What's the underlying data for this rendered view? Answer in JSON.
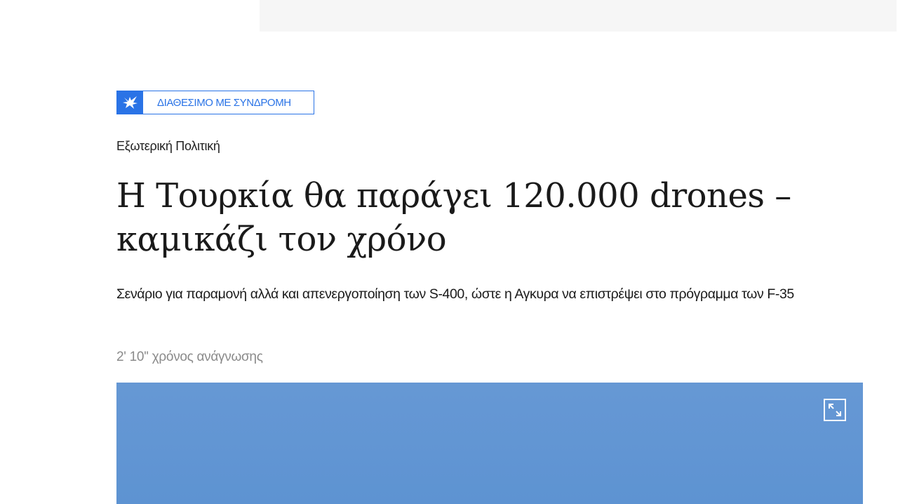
{
  "subscription_badge": {
    "text": "ΔΙΑΘΕΣΙΜΟ ΜΕ ΣΥΝΔΡΟΜΗ",
    "icon": "bird-logo-icon",
    "color": "#2a73e6"
  },
  "article": {
    "category": "Εξωτερική Πολιτική",
    "headline": "Η Τουρκία θα παράγει 120.000 drones – καμικάζι τον χρόνο",
    "lead": "Σενάριο για παραμονή αλλά και απενεργοποίηση των S-400, ώστε η Αγκυρα να επιστρέψει στο πρόγραμμα των F-35",
    "read_time": "2' 10'' χρόνος ανάγνωσης"
  },
  "hero_image": {
    "expand_icon": "expand-icon"
  }
}
